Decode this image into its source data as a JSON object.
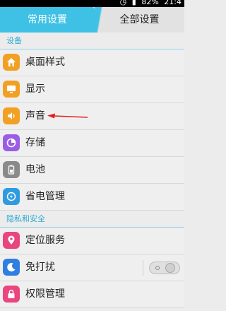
{
  "status_bar": {
    "battery": "82%",
    "time": "21:4"
  },
  "tabs": [
    {
      "label": "常用设置",
      "active": true
    },
    {
      "label": "全部设置",
      "active": false
    }
  ],
  "sections": [
    {
      "title": "设备",
      "items": [
        {
          "label": "桌面样式",
          "icon": "home-icon",
          "color": "#f2a024"
        },
        {
          "label": "显示",
          "icon": "monitor-icon",
          "color": "#f2a024"
        },
        {
          "label": "声音",
          "icon": "speaker-icon",
          "color": "#f2a024"
        },
        {
          "label": "存储",
          "icon": "storage-icon",
          "color": "#9b5de5"
        },
        {
          "label": "电池",
          "icon": "battery-icon",
          "color": "#8a8a8a"
        },
        {
          "label": "省电管理",
          "icon": "power-saving-icon",
          "color": "#2e9be0"
        }
      ]
    },
    {
      "title": "隐私和安全",
      "items": [
        {
          "label": "定位服务",
          "icon": "location-icon",
          "color": "#e9457e"
        },
        {
          "label": "免打扰",
          "icon": "moon-icon",
          "color": "#2e7fe0",
          "toggle": false
        },
        {
          "label": "权限管理",
          "icon": "lock-icon",
          "color": "#e9457e"
        }
      ]
    }
  ]
}
